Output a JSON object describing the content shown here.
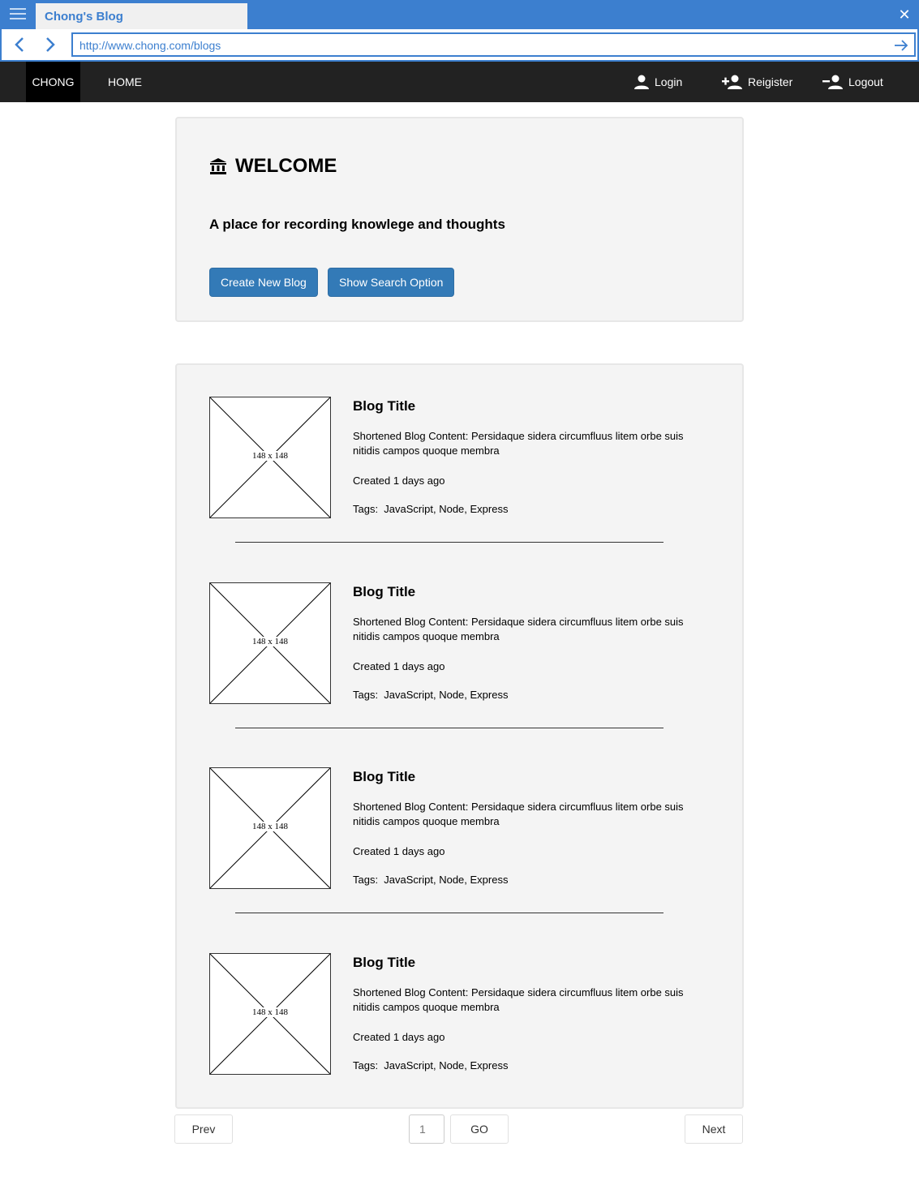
{
  "browser": {
    "tab_title": "Chong's Blog",
    "url": "http://www.chong.com/blogs",
    "accent_color": "#3c7fcf"
  },
  "nav": {
    "brand": "CHONG",
    "home": "HOME",
    "login": "Login",
    "register": "Reigister",
    "logout": "Logout"
  },
  "welcome": {
    "title": "WELCOME",
    "tagline": "A place for recording knowlege and thoughts",
    "create_button": "Create New Blog",
    "search_button": "Show Search Option"
  },
  "blogs": [
    {
      "thumb": "148 x 148",
      "title": "Blog Title",
      "content": "Shortened Blog Content: Persidaque sidera circumfluus litem orbe suis nitidis campos quoque membra",
      "created": "Created 1 days ago",
      "tags": "Tags:  JavaScript, Node, Express"
    },
    {
      "thumb": "148 x 148",
      "title": "Blog Title",
      "content": "Shortened Blog Content: Persidaque sidera circumfluus litem orbe suis nitidis campos quoque membra",
      "created": "Created 1 days ago",
      "tags": "Tags:  JavaScript, Node, Express"
    },
    {
      "thumb": "148 x 148",
      "title": "Blog Title",
      "content": "Shortened Blog Content: Persidaque sidera circumfluus litem orbe suis nitidis campos quoque membra",
      "created": "Created 1 days ago",
      "tags": "Tags:  JavaScript, Node, Express"
    },
    {
      "thumb": "148 x 148",
      "title": "Blog Title",
      "content": "Shortened Blog Content: Persidaque sidera circumfluus litem orbe suis nitidis campos quoque membra",
      "created": "Created 1 days ago",
      "tags": "Tags:  JavaScript, Node, Express"
    }
  ],
  "pagination": {
    "prev": "Prev",
    "page": "1",
    "go": "GO",
    "next": "Next"
  }
}
